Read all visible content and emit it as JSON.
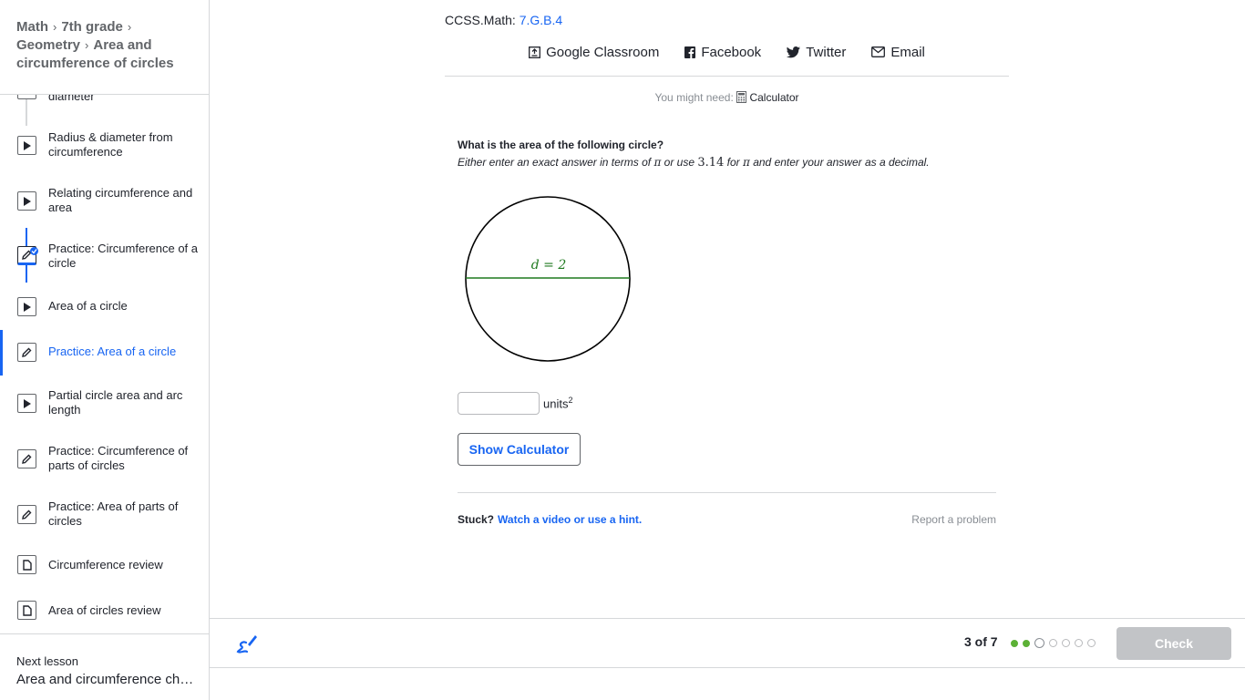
{
  "breadcrumb": {
    "items": [
      "Math",
      "7th grade",
      "Geometry",
      "Area and circumference of circles"
    ]
  },
  "sidebar": {
    "items": [
      {
        "label": "diameter",
        "icon": "play-icon"
      },
      {
        "label": "Radius & diameter from circumference",
        "icon": "play-icon"
      },
      {
        "label": "Relating circumference and area",
        "icon": "play-icon"
      },
      {
        "label": "Practice: Circumference of a circle",
        "icon": "pencil-icon",
        "completed": true
      },
      {
        "label": "Area of a circle",
        "icon": "play-icon"
      },
      {
        "label": "Practice: Area of a circle",
        "icon": "pencil-icon",
        "active": true
      },
      {
        "label": "Partial circle area and arc length",
        "icon": "play-icon"
      },
      {
        "label": "Practice: Circumference of parts of circles",
        "icon": "pencil-icon"
      },
      {
        "label": "Practice: Area of parts of circles",
        "icon": "pencil-icon"
      },
      {
        "label": "Circumference review",
        "icon": "article-icon"
      },
      {
        "label": "Area of circles review",
        "icon": "article-icon"
      }
    ],
    "next_lesson_label": "Next lesson",
    "next_lesson_title": "Area and circumference challenge problems"
  },
  "standard": {
    "prefix": "CCSS.Math: ",
    "code": "7.G.B.4"
  },
  "share": {
    "google_classroom": "Google Classroom",
    "facebook": "Facebook",
    "twitter": "Twitter",
    "email": "Email"
  },
  "tools": {
    "might_need": "You might need:",
    "calculator": "Calculator"
  },
  "question": {
    "prompt": "What is the area of the following circle?",
    "instr_1": "Either enter an exact answer in terms of ",
    "pi": "π",
    "instr_2": " or use ",
    "approx": "3.14",
    "instr_3": " for ",
    "instr_4": " and enter your answer as a decimal.",
    "diameter_label": "d = 2",
    "answer_value": "",
    "units": "units",
    "units_exp": "2"
  },
  "buttons": {
    "show_calculator": "Show Calculator",
    "check": "Check"
  },
  "help": {
    "stuck": "Stuck?",
    "hint": "Watch a video or use a hint.",
    "report": "Report a problem"
  },
  "progress": {
    "text": "3 of 7",
    "current": 3,
    "total": 7,
    "completed": 2
  },
  "colors": {
    "accent": "#1865f2",
    "diameter_line": "#1f7a1f",
    "progress_done": "#5cb136",
    "check_disabled": "#c2c4c7"
  }
}
